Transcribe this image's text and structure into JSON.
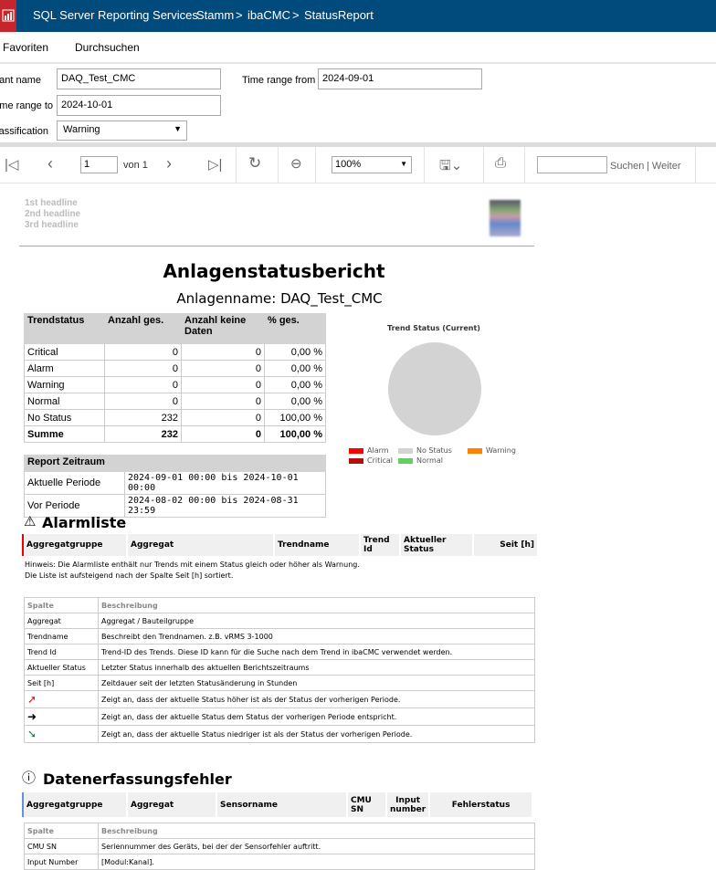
{
  "header": {
    "app": "SQL Server Reporting Services",
    "crumbs": [
      "Stamm",
      "ibaCMC",
      "StatusReport"
    ],
    "sep": ">"
  },
  "menu": {
    "favorites": "Favoriten",
    "browse": "Durchsuchen"
  },
  "params": {
    "plant_label": "Plant name",
    "plant_value": "DAQ_Test_CMC",
    "from_label": "Time range from",
    "from_value": "2024-09-01",
    "to_label": "Time range to",
    "to_value": "2024-10-01",
    "class_label": "Classification",
    "class_value": "Warning"
  },
  "toolbar": {
    "page": "1",
    "of": "von 1",
    "zoom": "100%",
    "find": "Suchen",
    "next": "| Weiter"
  },
  "report": {
    "headlines": [
      "1st headline",
      "2nd headline",
      "3rd headline"
    ],
    "title": "Anlagenstatusbericht",
    "subtitle": "Anlagenname: DAQ_Test_CMC",
    "status_headers": [
      "Trendstatus",
      "Anzahl ges.",
      "Anzahl keine Daten",
      "% ges."
    ],
    "status_rows": [
      [
        "Critical",
        "0",
        "0",
        "0,00 %"
      ],
      [
        "Alarm",
        "0",
        "0",
        "0,00 %"
      ],
      [
        "Warning",
        "0",
        "0",
        "0,00 %"
      ],
      [
        "Normal",
        "0",
        "0",
        "0,00 %"
      ],
      [
        "No Status",
        "232",
        "0",
        "100,00 %"
      ]
    ],
    "sum_row": [
      "Summe",
      "232",
      "0",
      "100,00 %"
    ],
    "period_title": "Report Zeitraum",
    "periods": [
      [
        "Aktuelle Periode",
        "2024-09-01 00:00 bis 2024-10-01 00:00"
      ],
      [
        "Vor Periode",
        "2024-08-02 00:00 bis 2024-08-31 23:59"
      ]
    ],
    "alarm_title": "Alarmliste",
    "alarm_headers": [
      "Aggregatgruppe",
      "Aggregat",
      "Trendname",
      "Trend Id",
      "Aktueller Status",
      "Seit [h]"
    ],
    "hint1": "Hinweis: Die Alarmliste enthält nur Trends mit einem Status gleich oder höher als Warnung.",
    "hint2": "Die Liste ist aufsteigend nach der Spalte Seit [h] sortiert.",
    "alarm_desc": [
      [
        "Spalte",
        "Beschreibung"
      ],
      [
        "Aggregat",
        "Aggregat / Bauteilgruppe"
      ],
      [
        "Trendname",
        "Beschreibt den Trendnamen. z.B. vRMS 3-1000"
      ],
      [
        "Trend Id",
        "Trend-ID des Trends. Diese ID kann für die Suche nach dem Trend in ibaCMC verwendet werden."
      ],
      [
        "Aktueller Status",
        "Letzter Status innerhalb des aktuellen Berichtszeitraums"
      ],
      [
        "Seit [h]",
        "Zeitdauer seit der letzten Statusänderung in Stunden"
      ],
      [
        "",
        "Zeigt an, dass der aktuelle Status höher ist als der Status der vorherigen Periode."
      ],
      [
        "",
        "Zeigt an, dass der aktuelle Status dem Status der vorherigen Periode entspricht."
      ],
      [
        "",
        "Zeigt an, dass der aktuelle Status niedriger ist als der Status der vorherigen Periode."
      ]
    ],
    "daq_title": "Datenerfassungsfehler",
    "daq_headers": [
      "Aggregatgruppe",
      "Aggregat",
      "Sensorname",
      "CMU SN",
      "Input number",
      "Fehlerstatus"
    ],
    "daq_desc": [
      [
        "Spalte",
        "Beschreibung"
      ],
      [
        "CMU SN",
        "Seriennummer des Geräts, bei der der Sensorfehler auftritt."
      ],
      [
        "Input Number",
        "[Modul:Kanal]."
      ]
    ]
  },
  "chart_data": {
    "type": "pie",
    "title": "Trend Status (Current)",
    "categories": [
      "Alarm",
      "No Status",
      "Warning",
      "Critical",
      "Normal"
    ],
    "values": [
      0,
      232,
      0,
      0,
      0
    ],
    "colors": [
      "#ff0000",
      "#d3d3d3",
      "#ff8000",
      "#b01010",
      "#66cc66"
    ],
    "legend": "bottom"
  }
}
